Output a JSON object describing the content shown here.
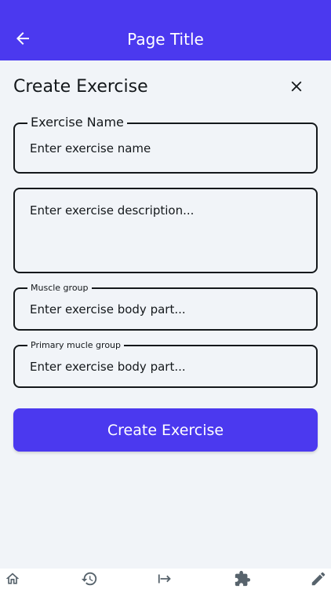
{
  "appbar": {
    "title": "Page Title"
  },
  "form": {
    "heading": "Create Exercise",
    "exercise_name": {
      "label": "Exercise Name",
      "placeholder": "Enter exercise name"
    },
    "description": {
      "placeholder": "Enter exercise description..."
    },
    "muscle_group": {
      "label": "Muscle group",
      "placeholder": "Enter exercise body part..."
    },
    "primary_muscle_group": {
      "label": "Primary mucle group",
      "placeholder": "Enter exercise body part..."
    },
    "submit_label": "Create Exercise"
  },
  "colors": {
    "primary": "#4b39ef",
    "background": "#f1f4f8",
    "text": "#14181b",
    "icon": "#57636c"
  },
  "bottom_nav": {
    "items": [
      "home-icon",
      "history-icon",
      "arrow-right-to-bar-icon",
      "puzzle-icon",
      "pencil-icon"
    ]
  }
}
